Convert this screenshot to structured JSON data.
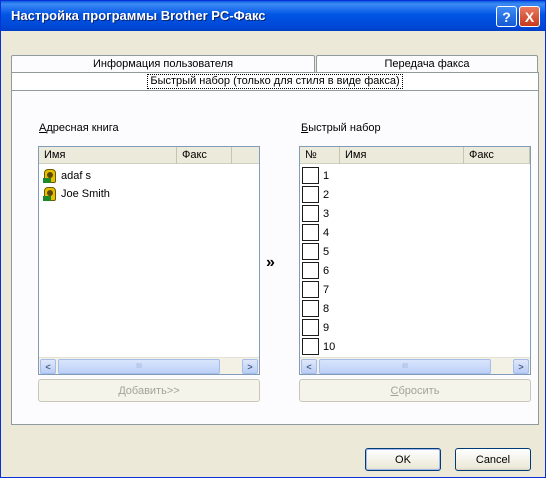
{
  "window": {
    "title": "Настройка программы Brother PC-Факс",
    "help_glyph": "?",
    "close_glyph": "X"
  },
  "tabs": {
    "user_info": "Информация пользователя",
    "fax_send": "Передача факса",
    "speed_dial_tab": "Быстрый набор (только для стиля в виде факса)"
  },
  "address_book": {
    "label_first": "А",
    "label_rest": "дресная книга",
    "col_name": "Имя",
    "col_fax": "Факс",
    "entries": [
      "adaf s",
      "Joe Smith"
    ],
    "add_button_first": "Д",
    "add_button_rest": "обавить>>"
  },
  "move_arrow": "»",
  "speed_dial": {
    "label_first": "Б",
    "label_rest": "ыстрый набор",
    "col_no": "№",
    "col_name": "Имя",
    "col_fax": "Факс",
    "numbers": [
      "1",
      "2",
      "3",
      "4",
      "5",
      "6",
      "7",
      "8",
      "9",
      "10"
    ],
    "reset_button_first": "С",
    "reset_button_rest": "бросить"
  },
  "scroll": {
    "left_glyph": "<",
    "right_glyph": ">",
    "thumb_glyph": "III"
  },
  "footer": {
    "ok_label": "OK",
    "cancel_label": "Cancel"
  }
}
